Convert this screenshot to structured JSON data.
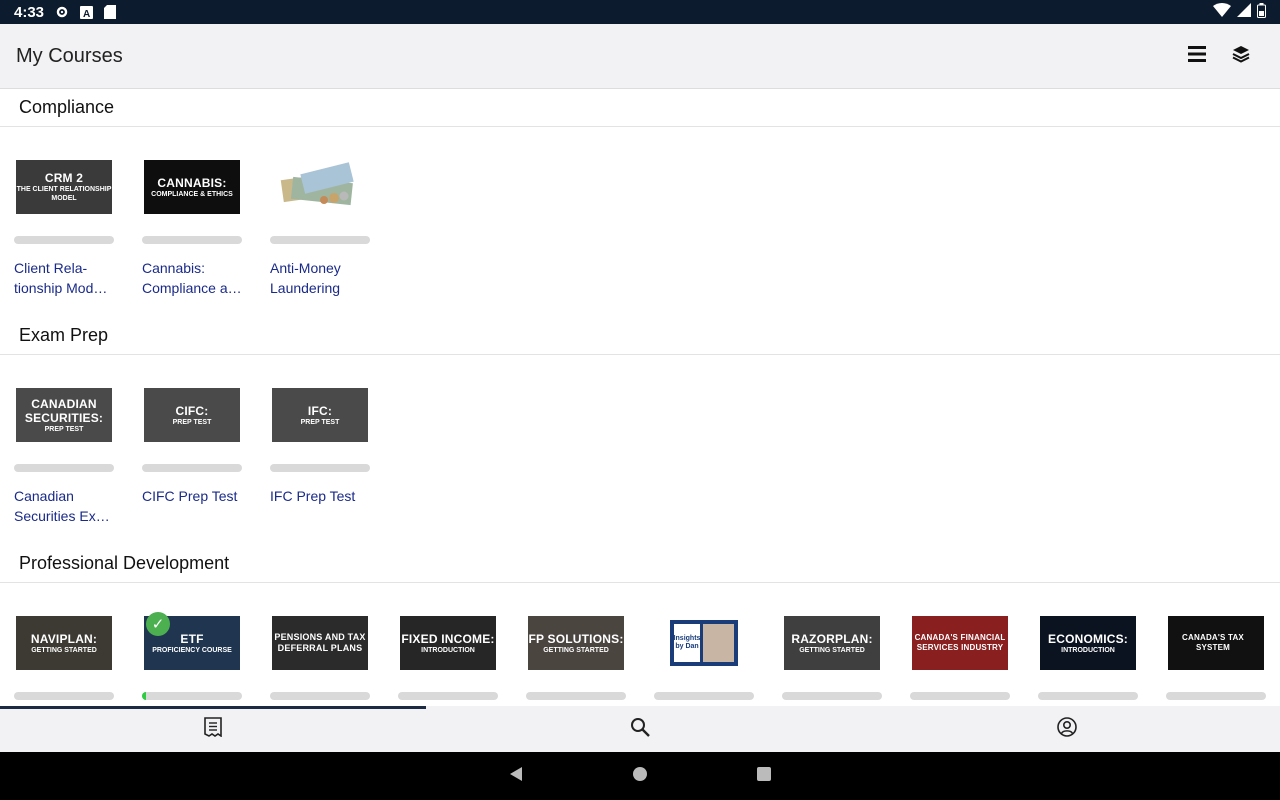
{
  "status": {
    "time": "4:33"
  },
  "appbar": {
    "title": "My Courses",
    "icons": [
      "list-icon",
      "layers-icon"
    ]
  },
  "sections": [
    {
      "name": "Compliance",
      "courses": [
        {
          "title": "Client Rela-tionship Mod…",
          "thumb_lines": [
            "CRM 2",
            "THE CLIENT RELATIONSHIP MODEL"
          ],
          "thumb_color": "#3a3a3a",
          "progress": 0
        },
        {
          "title": "Cannabis: Compliance a…",
          "thumb_lines": [
            "CANNABIS:",
            "COMPLIANCE & ETHICS"
          ],
          "thumb_color": "#0e0e0e",
          "progress": 0
        },
        {
          "title": "Anti-Money Laundering",
          "thumb_lines": [
            "",
            ""
          ],
          "thumb_color": "#e8e4d8",
          "progress": 0
        }
      ]
    },
    {
      "name": "Exam Prep",
      "courses": [
        {
          "title": "Canadian Securities Ex…",
          "thumb_lines": [
            "CANADIAN SECURITIES:",
            "PREP TEST"
          ],
          "thumb_color": "#4a4a4a",
          "progress": 0
        },
        {
          "title": "CIFC Prep Test",
          "thumb_lines": [
            "CIFC:",
            "PREP TEST"
          ],
          "thumb_color": "#4a4a4a",
          "progress": 0
        },
        {
          "title": "IFC Prep Test",
          "thumb_lines": [
            "IFC:",
            "PREP TEST"
          ],
          "thumb_color": "#4a4a4a",
          "progress": 0
        }
      ]
    },
    {
      "name": "Professional Development",
      "courses": [
        {
          "thumb_lines": [
            "NAVIPLAN:",
            "GETTING STARTED"
          ],
          "thumb_color": "#3d3a33",
          "progress": 0
        },
        {
          "thumb_lines": [
            "ETF",
            "PROFICIENCY COURSE"
          ],
          "thumb_color": "#1f3550",
          "progress": 0.04,
          "completed": true
        },
        {
          "thumb_lines": [
            "PENSIONS AND TAX DEFERRAL PLANS",
            ""
          ],
          "thumb_color": "#2b2b2b",
          "progress": 0
        },
        {
          "thumb_lines": [
            "FIXED INCOME:",
            "INTRODUCTION"
          ],
          "thumb_color": "#262626",
          "progress": 0
        },
        {
          "thumb_lines": [
            "FP SOLUTIONS:",
            "GETTING STARTED"
          ],
          "thumb_color": "#4b4540",
          "progress": 0
        },
        {
          "thumb_lines": [
            "Insights by Dan",
            ""
          ],
          "thumb_color": "#ffffff",
          "progress": 0
        },
        {
          "thumb_lines": [
            "RAZORPLAN:",
            "GETTING STARTED"
          ],
          "thumb_color": "#3f3f3f",
          "progress": 0
        },
        {
          "thumb_lines": [
            "CANADA'S FINANCIAL SERVICES INDUSTRY",
            ""
          ],
          "thumb_color": "#8a1f1f",
          "progress": 0
        },
        {
          "thumb_lines": [
            "ECONOMICS:",
            "INTRODUCTION"
          ],
          "thumb_color": "#0c1320",
          "progress": 0
        },
        {
          "thumb_lines": [
            "CANADA'S TAX SYSTEM",
            ""
          ],
          "thumb_color": "#111111",
          "progress": 0
        }
      ]
    }
  ],
  "tabs": [
    {
      "icon": "receipt-icon",
      "active": true
    },
    {
      "icon": "search-icon",
      "active": false
    },
    {
      "icon": "profile-icon",
      "active": false
    }
  ]
}
